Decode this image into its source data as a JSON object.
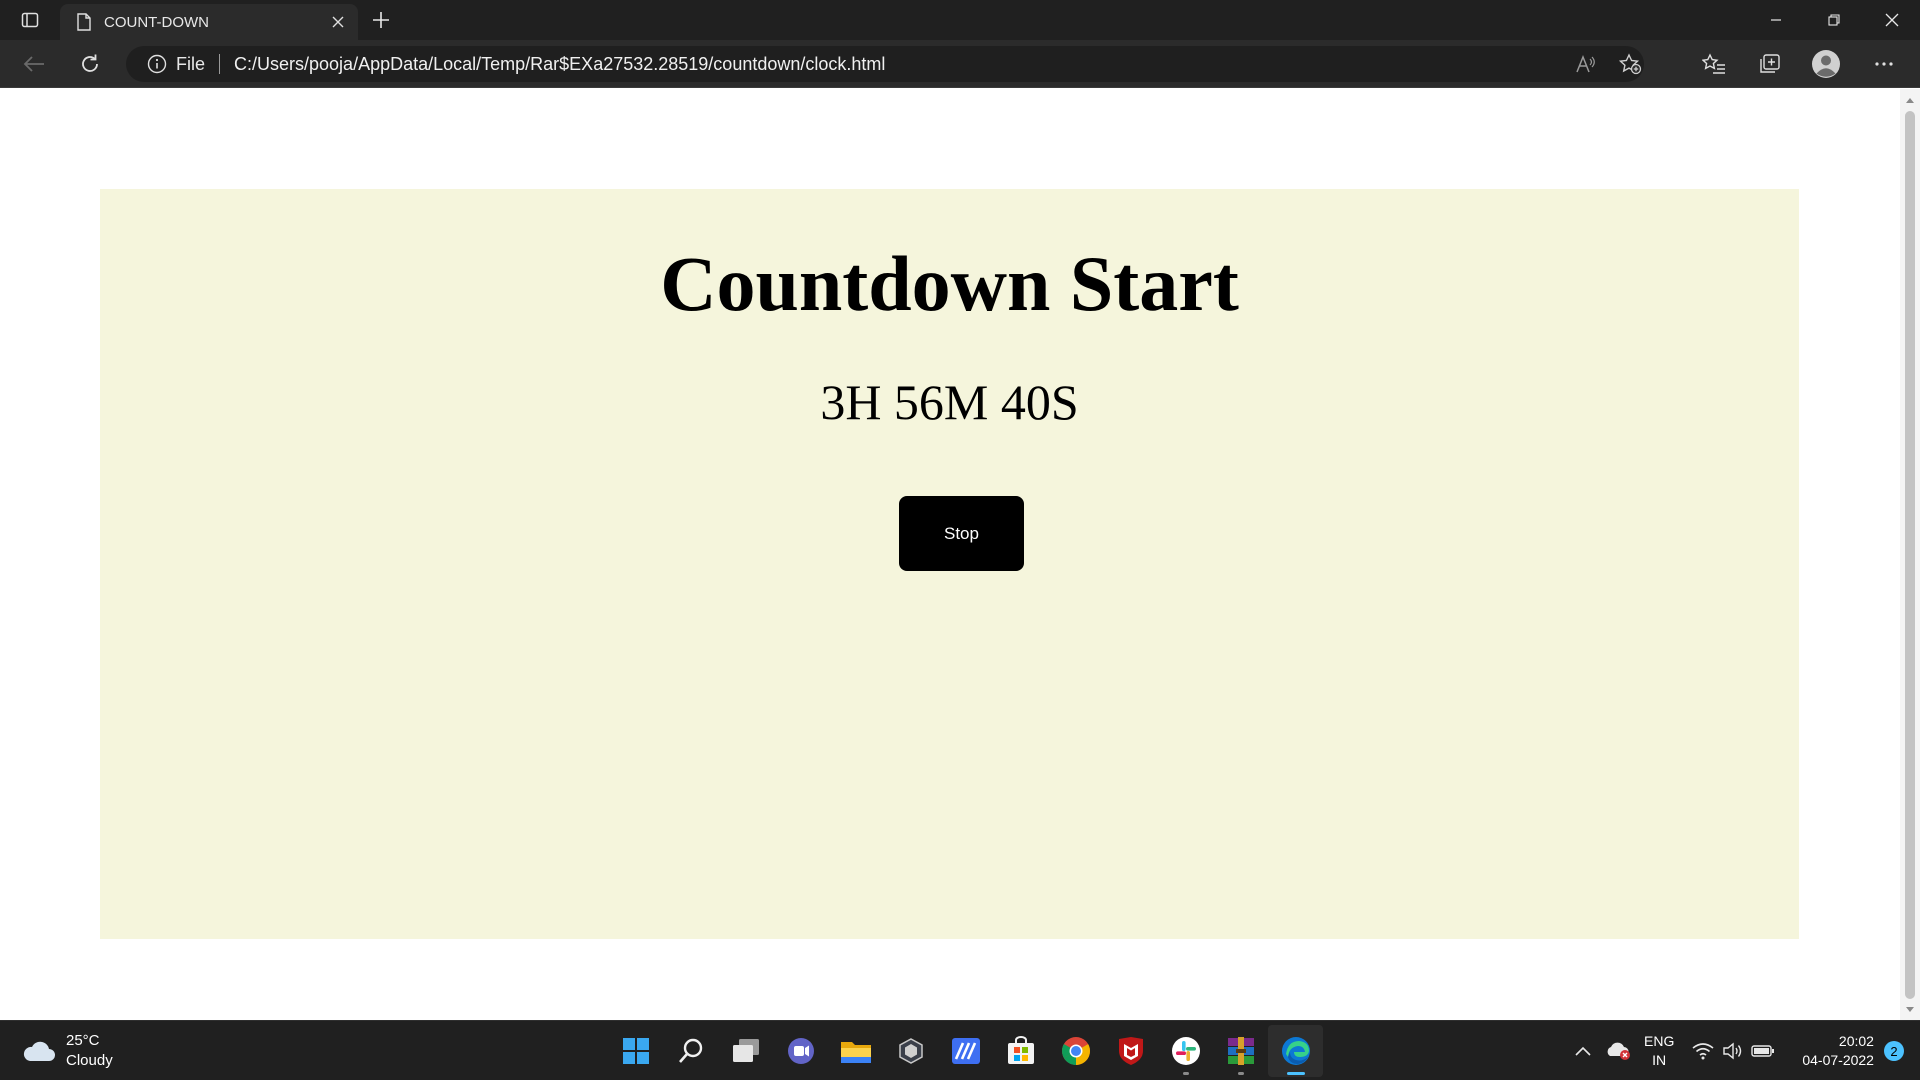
{
  "browser": {
    "tab": {
      "title": "COUNT-DOWN",
      "icon": "page-icon"
    },
    "address": {
      "scheme_label": "File",
      "url": "C:/Users/pooja/AppData/Local/Temp/Rar$EXa27532.28519/countdown/clock.html"
    },
    "icons": [
      "tab-actions-icon",
      "close-icon",
      "plus-icon",
      "minimize-icon",
      "restore-icon",
      "close-window-icon",
      "back-arrow-icon",
      "refresh-icon",
      "info-icon",
      "read-aloud-icon",
      "add-favorite-icon",
      "favorites-icon",
      "collections-icon",
      "profile-icon",
      "more-icon"
    ]
  },
  "page": {
    "heading": "Countdown Start",
    "timer": "3H 56M 40S",
    "stop_label": "Stop",
    "card_color": "#f5f5dc",
    "button_color": "#000000"
  },
  "taskbar": {
    "weather": {
      "temp": "25°C",
      "condition": "Cloudy"
    },
    "apps": [
      "start-icon",
      "search-icon",
      "task-view-icon",
      "chat-icon",
      "file-explorer-icon",
      "app-icon",
      "mathpix-icon",
      "store-icon",
      "chrome-icon",
      "mcafee-icon",
      "slack-icon",
      "winrar-icon",
      "edge-icon"
    ],
    "tray": {
      "lang_line1": "ENG",
      "lang_line2": "IN",
      "time": "20:02",
      "date": "04-07-2022",
      "notifications": "2"
    }
  }
}
